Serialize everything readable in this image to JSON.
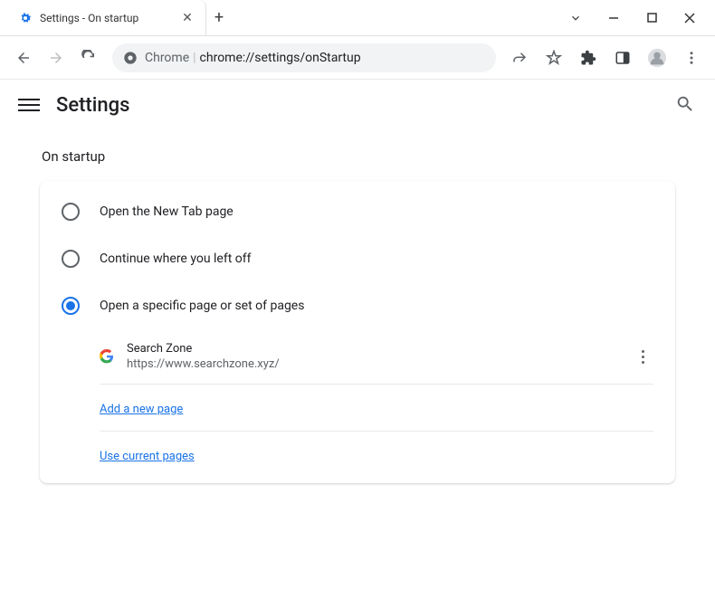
{
  "tab": {
    "title": "Settings - On startup"
  },
  "url": {
    "prefix": "Chrome",
    "path": "chrome://settings/onStartup"
  },
  "header": {
    "title": "Settings"
  },
  "section": {
    "title": "On startup"
  },
  "options": {
    "new_tab": "Open the New Tab page",
    "continue": "Continue where you left off",
    "specific": "Open a specific page or set of pages"
  },
  "pages": [
    {
      "name": "Search Zone",
      "url": "https://www.searchzone.xyz/"
    }
  ],
  "links": {
    "add_page": "Add a new page",
    "use_current": "Use current pages"
  }
}
